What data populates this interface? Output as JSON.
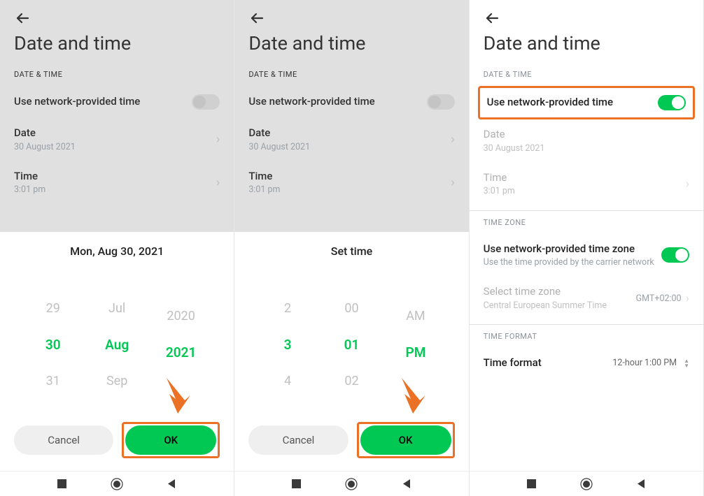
{
  "common": {
    "page_title": "Date and time",
    "section_datetime": "DATE & TIME",
    "use_network_time": "Use network-provided time",
    "date_label": "Date",
    "date_value": "30 August 2021",
    "time_label": "Time",
    "time_value": "3:01 pm",
    "cancel": "Cancel",
    "ok": "OK"
  },
  "date_picker": {
    "title": "Mon, Aug 30, 2021",
    "cols": [
      {
        "above": "29",
        "sel": "30",
        "below": "31"
      },
      {
        "above": "Jul",
        "sel": "Aug",
        "below": "Sep"
      },
      {
        "above": "2020",
        "sel": "2021",
        "below": ""
      }
    ]
  },
  "time_picker": {
    "title": "Set time",
    "cols": [
      {
        "above": "2",
        "sel": "3",
        "below": "4"
      },
      {
        "above": "00",
        "sel": "01",
        "below": "02"
      },
      {
        "above": "AM",
        "sel": "PM",
        "below": ""
      }
    ]
  },
  "screen3": {
    "section_timezone": "TIME ZONE",
    "use_network_tz": "Use network-provided time zone",
    "use_network_tz_sub": "Use the time provided by the carrier network",
    "select_tz": "Select time zone",
    "select_tz_sub": "Central European Summer Time",
    "select_tz_value": "GMT+02:00",
    "section_timeformat": "TIME FORMAT",
    "time_format": "Time format",
    "time_format_value": "12-hour 1:00 PM"
  }
}
